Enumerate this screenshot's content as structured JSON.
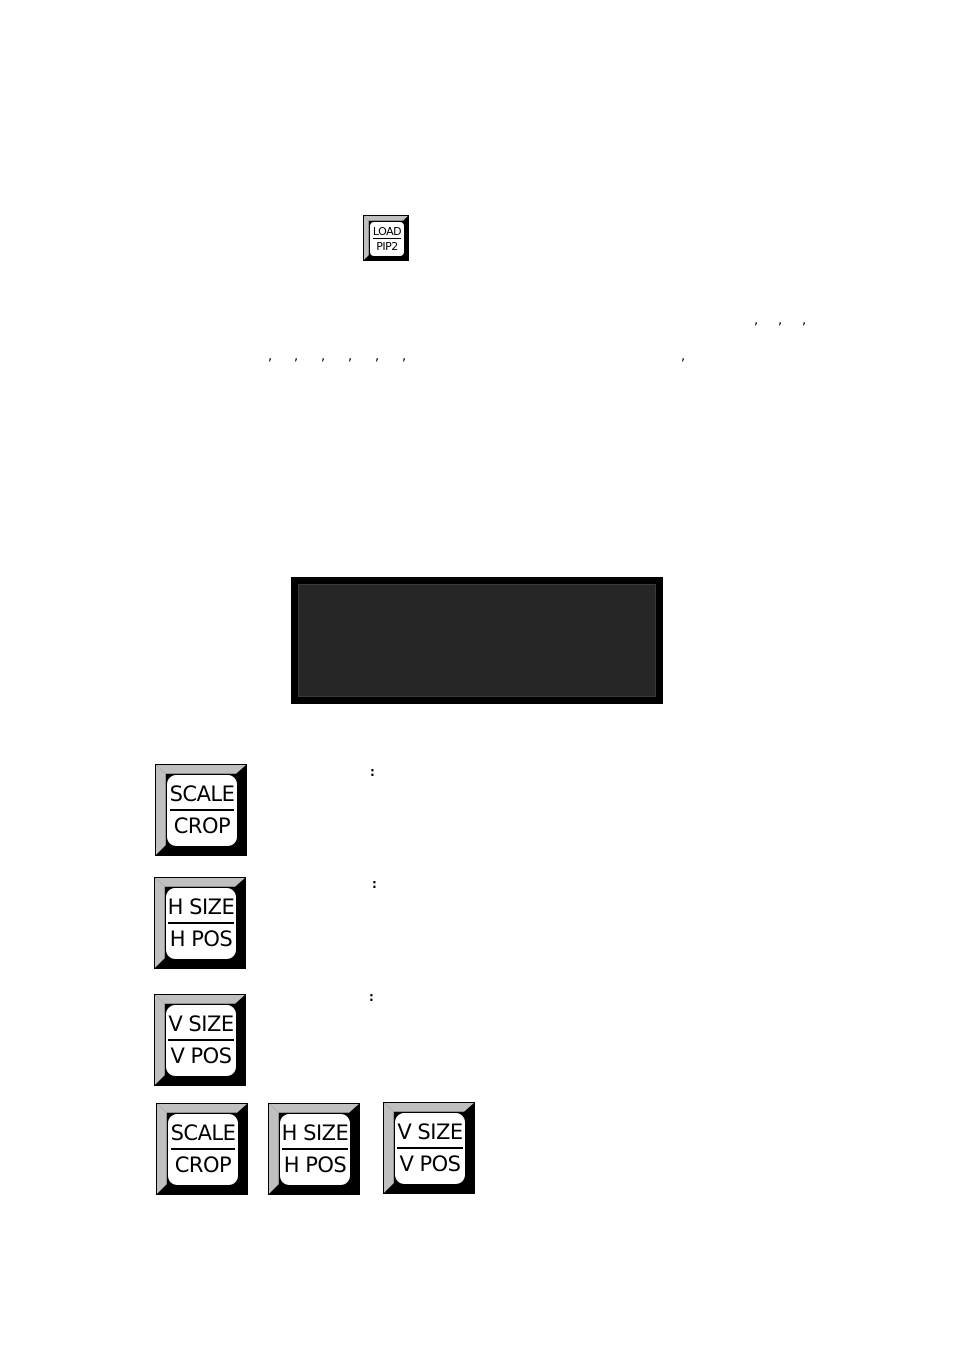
{
  "load_key": {
    "line1": "LOAD",
    "line2": "PIP2"
  },
  "punctuation": {
    "row1": [
      ",",
      ",",
      ","
    ],
    "row2": [
      ",",
      ",",
      ",",
      ",",
      ",",
      ","
    ],
    "row2_right": ","
  },
  "display": {
    "text": ""
  },
  "sections": [
    {
      "key": {
        "line1": "SCALE",
        "line2": "CROP"
      },
      "colon": ":"
    },
    {
      "key": {
        "line1": "H SIZE",
        "line2": "H POS"
      },
      "colon": ":"
    },
    {
      "key": {
        "line1": "V SIZE",
        "line2": "V POS"
      },
      "colon": ":"
    }
  ],
  "key_row": [
    {
      "line1": "SCALE",
      "line2": "CROP"
    },
    {
      "line1": "H SIZE",
      "line2": "H POS"
    },
    {
      "line1": "V SIZE",
      "line2": "V POS"
    }
  ],
  "colors": {
    "bevel_light": "#c0c0c0",
    "bevel_dark": "#000000",
    "key_face": "#ffffff",
    "display_bg": "#262626"
  }
}
